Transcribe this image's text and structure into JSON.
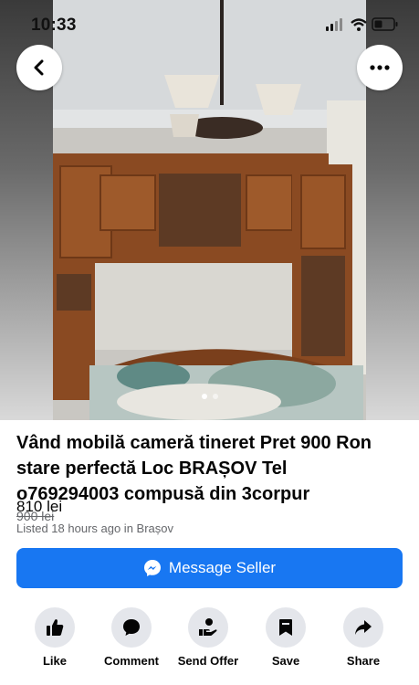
{
  "status_bar": {
    "time": "10:33"
  },
  "listing": {
    "title": "Vând mobilă cameră tineret Pret 900 Ron stare perfectă Loc BRAȘOV Tel o769294003 compusă din 3corpur",
    "price": "810 lei",
    "original_price": "900 lei",
    "listed_info": "Listed 18 hours ago in Brașov"
  },
  "photo": {
    "count": 2,
    "current": 1
  },
  "message_button": {
    "label": "Message Seller",
    "icon": "messenger-icon"
  },
  "actions": [
    {
      "label": "Like",
      "icon": "thumbs-up-icon"
    },
    {
      "label": "Comment",
      "icon": "comment-icon"
    },
    {
      "label": "Send Offer",
      "icon": "offer-icon"
    },
    {
      "label": "Save",
      "icon": "bookmark-icon"
    },
    {
      "label": "Share",
      "icon": "share-icon"
    }
  ],
  "colors": {
    "accent": "#1877f2",
    "action_bg": "#e4e6eb",
    "secondary_text": "#65676b"
  }
}
